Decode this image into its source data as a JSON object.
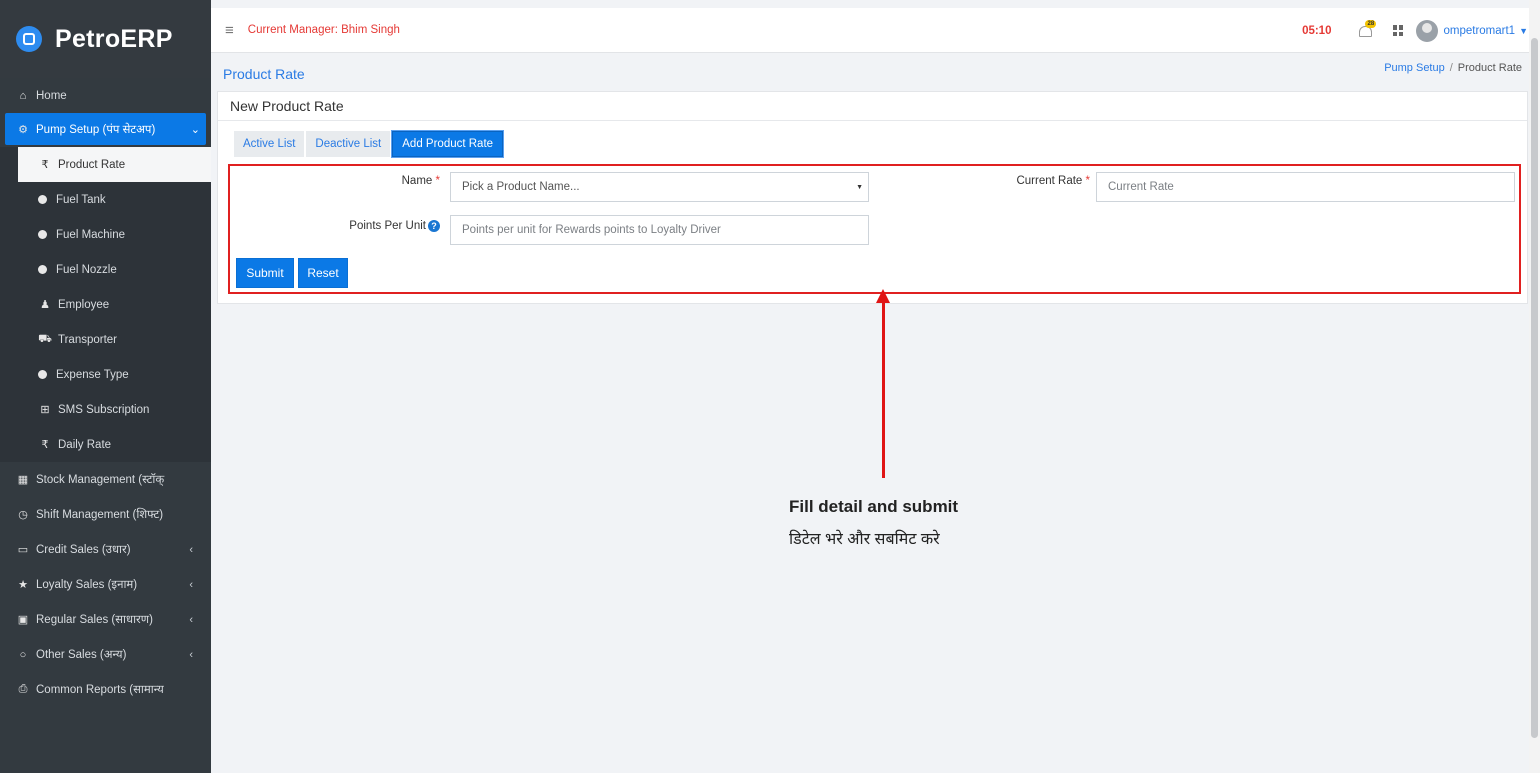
{
  "app": {
    "brand": "PetroERP"
  },
  "sidebar": {
    "items": [
      {
        "label": "Home",
        "icon": "home-icon"
      },
      {
        "label": "Pump Setup (पंप सेटअप)",
        "icon": "gears-icon",
        "active": true
      },
      {
        "label": "Stock Management (स्टॉक्",
        "icon": "cubes-icon"
      },
      {
        "label": "Shift Management (शिफ्ट)",
        "icon": "clock-icon"
      },
      {
        "label": "Credit Sales (उधार)",
        "icon": "credit-card-icon"
      },
      {
        "label": "Loyalty Sales (इनाम)",
        "icon": "trophy-icon"
      },
      {
        "label": "Regular Sales (साधारण)",
        "icon": "cube-icon"
      },
      {
        "label": "Other Sales (अन्य)",
        "icon": "circle-icon"
      },
      {
        "label": "Common Reports (सामान्य",
        "icon": "print-icon"
      }
    ],
    "subitems": [
      {
        "label": "Product Rate",
        "icon": "rupee-icon",
        "current": true
      },
      {
        "label": "Fuel Tank",
        "icon": "dot-icon"
      },
      {
        "label": "Fuel Machine",
        "icon": "dot-icon"
      },
      {
        "label": "Fuel Nozzle",
        "icon": "dot-icon"
      },
      {
        "label": "Employee",
        "icon": "user-icon"
      },
      {
        "label": "Transporter",
        "icon": "truck-icon"
      },
      {
        "label": "Expense Type",
        "icon": "dot-icon"
      },
      {
        "label": "SMS Subscription",
        "icon": "plus-square-icon"
      },
      {
        "label": "Daily Rate",
        "icon": "rupee-icon"
      }
    ]
  },
  "topbar": {
    "manager": "Current Manager: Bhim Singh",
    "timer": "05:10",
    "notification_count": "28",
    "username": "ompetromart1"
  },
  "page": {
    "title": "Product Rate",
    "breadcrumb": {
      "parent": "Pump Setup",
      "separator": "/",
      "current": "Product Rate"
    }
  },
  "card": {
    "title": "New Product Rate",
    "tabs": [
      "Active List",
      "Deactive List",
      "Add Product Rate"
    ],
    "active_tab": "Add Product Rate"
  },
  "form": {
    "name_label": "Name",
    "name_placeholder": "Pick a Product Name...",
    "current_rate_label": "Current Rate",
    "current_rate_placeholder": "Current Rate",
    "points_label": "Points Per Unit",
    "points_placeholder": "Points per unit for Rewards points to Loyalty Driver",
    "required_mark": "*",
    "submit_label": "Submit",
    "reset_label": "Reset"
  },
  "annotation": {
    "line1": "Fill detail and submit",
    "line2": "डिटेल भरे और सबमिट करे"
  },
  "colors": {
    "sidebar_bg": "#333a40",
    "primary": "#0b79e6",
    "link": "#2a7be4",
    "alert": "#e53935",
    "annotation_red": "#e01515"
  }
}
